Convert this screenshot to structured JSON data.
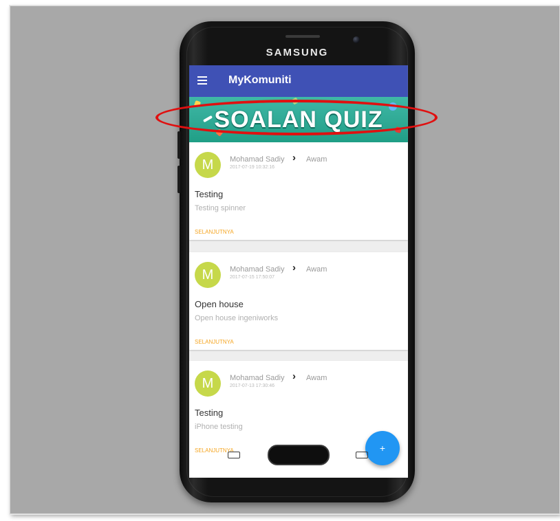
{
  "device": {
    "brand": "SAMSUNG"
  },
  "app": {
    "title": "MyKomuniti",
    "menu_icon": "hamburger-menu-icon",
    "banner_text": "SOALAN QUIZ",
    "colors": {
      "appbar": "#3f51b5",
      "banner": "#2ea893",
      "avatar": "#c6d84a",
      "link": "#f5a623",
      "fab": "#2196f3",
      "highlight": "#e01010"
    }
  },
  "posts": [
    {
      "avatar_letter": "M",
      "author": "Mohamad Sadiy",
      "group": "Awam",
      "timestamp": "2017-07-19 10:32:16",
      "title": "Testing",
      "body": "Testing spinner",
      "more": "SELANJUTNYA"
    },
    {
      "avatar_letter": "M",
      "author": "Mohamad Sadiy",
      "group": "Awam",
      "timestamp": "2017-07-15 17:50:07",
      "title": "Open house",
      "body": "Open house ingeniworks",
      "more": "SELANJUTNYA"
    },
    {
      "avatar_letter": "M",
      "author": "Mohamad Sadiy",
      "group": "Awam",
      "timestamp": "2017-07-13 17:30:46",
      "title": "Testing",
      "body": "iPhone testing",
      "more": "SELANJUTNYA"
    }
  ],
  "fab": {
    "label": "+"
  }
}
